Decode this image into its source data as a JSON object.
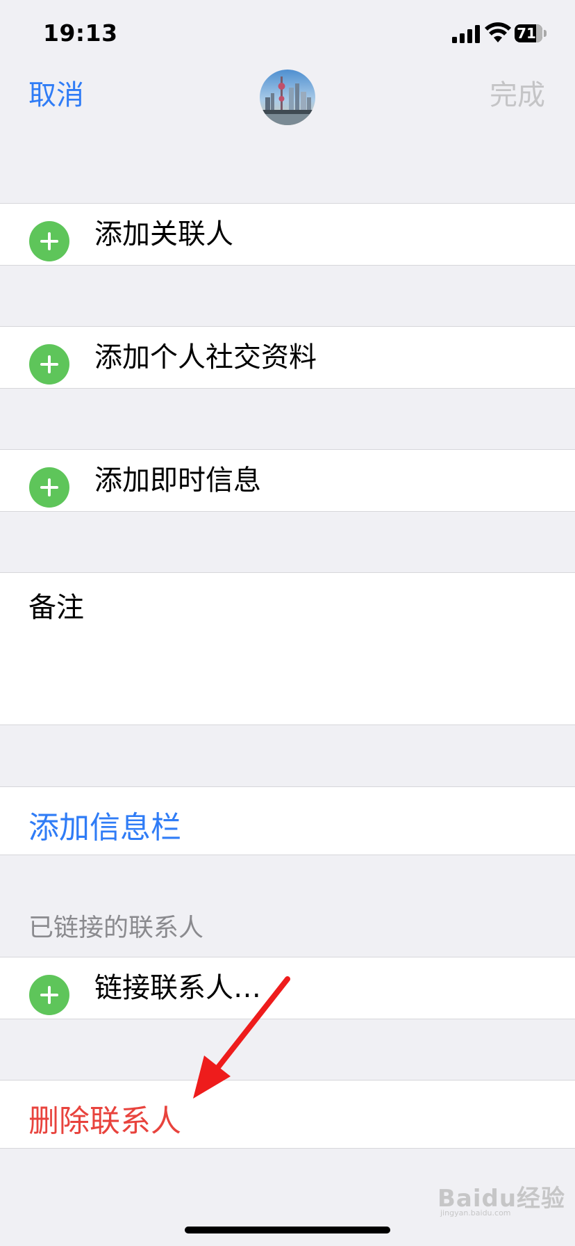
{
  "status_bar": {
    "time": "19:13",
    "battery_level": "71",
    "icons": [
      "cellular-signal-icon",
      "wifi-icon",
      "battery-icon"
    ]
  },
  "nav": {
    "cancel_label": "取消",
    "done_label": "完成"
  },
  "rows": {
    "add_related": "添加关联人",
    "add_social": "添加个人社交资料",
    "add_im": "添加即时信息",
    "notes_label": "备注",
    "add_field": "添加信息栏",
    "linked_header": "已链接的联系人",
    "link_contacts": "链接联系人…",
    "delete_contact": "删除联系人"
  },
  "watermark": {
    "brand": "Baidu经验",
    "url": "jingyan.baidu.com"
  },
  "colors": {
    "accent_blue": "#2f7cf6",
    "destructive_red": "#e8433d",
    "add_green": "#5ec55a",
    "background": "#f0f0f4",
    "annotation_arrow": "#ee1c1c"
  }
}
